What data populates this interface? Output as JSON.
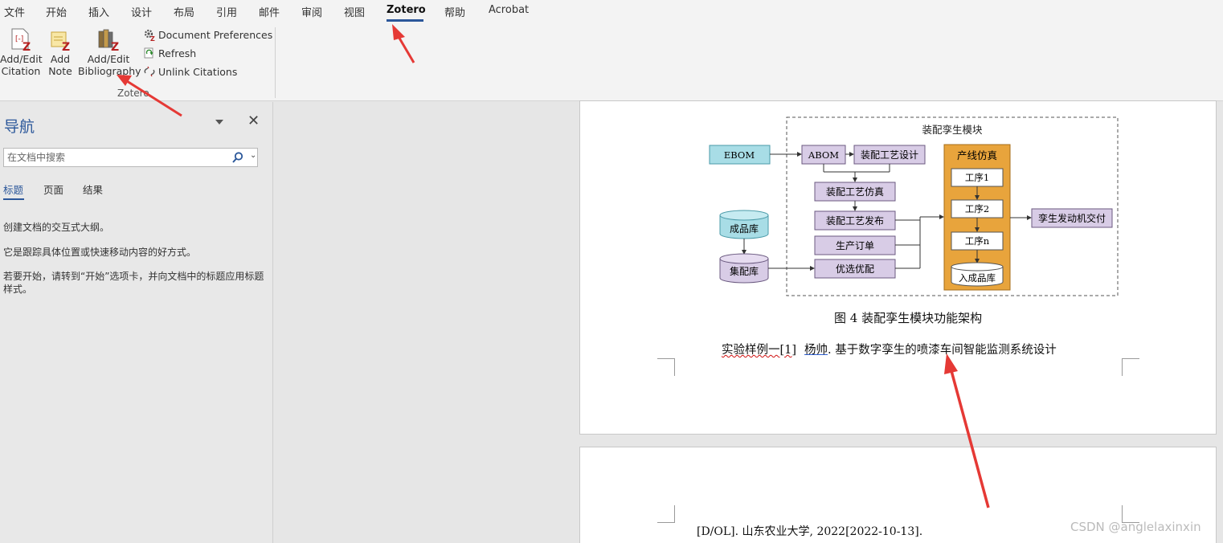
{
  "menu": {
    "items": [
      "文件",
      "开始",
      "插入",
      "设计",
      "布局",
      "引用",
      "邮件",
      "审阅",
      "视图",
      "Zotero",
      "帮助",
      "Acrobat"
    ],
    "active": "Zotero"
  },
  "ribbon": {
    "add_edit_citation": "Add/Edit\nCitation",
    "add_note": "Add\nNote",
    "add_edit_bibliography": "Add/Edit\nBibliography",
    "document_preferences": "Document Preferences",
    "refresh": "Refresh",
    "unlink_citations": "Unlink Citations",
    "group_label": "Zotero",
    "accent_color": "#b52121"
  },
  "nav": {
    "title": "导航",
    "search_placeholder": "在文档中搜索",
    "tabs": [
      "标题",
      "页面",
      "结果"
    ],
    "active_tab": "标题",
    "hint1": "创建文档的交互式大纲。",
    "hint2": "它是跟踪具体位置或快速移动内容的好方式。",
    "hint3": "若要开始，请转到“开始”选项卡，并向文档中的标题应用标题样式。"
  },
  "figure": {
    "module_title": "装配孪生模块",
    "ebom": "EBOM",
    "abom": "ABOM",
    "process_design": "装配工艺设计",
    "process_sim": "装配工艺仿真",
    "process_release": "装配工艺发布",
    "production_order": "生产订单",
    "optimize": "优选优配",
    "product_store": "成品库",
    "kit_store": "集配库",
    "line_sim": "产线仿真",
    "step1": "工序1",
    "step2": "工序2",
    "stepn": "工序n",
    "into_store": "入成品库",
    "delivery": "孪生发动机交付",
    "caption": "图 4  装配孪生模块功能架构",
    "colors": {
      "purple_box": "#d8cce6",
      "cyan_box": "#a8dde6",
      "orange_panel": "#e8a43c"
    }
  },
  "document": {
    "ref_prefix": "实验样例一[1]",
    "ref_author": "杨帅",
    "ref_title": ". 基于数字孪生的喷漆车间智能监测系统设计",
    "ref_cont": "[D/OL].  山东农业大学, 2022[2022-10-13]."
  },
  "watermark": "CSDN @anglelaxinxin"
}
